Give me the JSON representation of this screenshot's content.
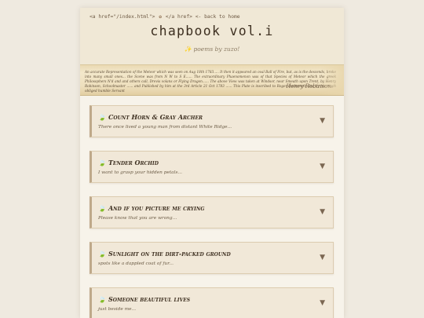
{
  "header": {
    "nav_open_tag": "<a href=\"/index.html\">",
    "nav_flower": "✿",
    "nav_close_tag": "</a href>",
    "back_link": "<- back to home",
    "title": "chapbook vol.i",
    "subtitle": "✨ poems by zuzo!"
  },
  "banner": {
    "text": "An accurate Representation of the Meteor which was seen on Aug 18th 1783..... It then it appeared an oval Ball of Fire, but, as is the descends, broke into many small ones... the Scene was from N W to S E...... The extraordinary Phaenomenon was of that Species of Meteor which the greek Philosophers N'd and and others call, Drevis volans or Flying Dragon...... The above View was taken at Windsor, near Smeath upon Trent, by Henry Robinson, Schoolmaster ...... and Published by him at the 3rd Article 21 Oct 1783 ...... This Plate is inscribed to Roger Dodsworth Esq by his much obliged humble Servant",
    "signature": "Henry Robinson."
  },
  "poems": [
    {
      "title": "Count Horn & Gray Archer",
      "excerpt": "There once lived a young man from distant White Ridge..."
    },
    {
      "title": "Tender Orchid",
      "excerpt": "I want to grasp your hidden petals..."
    },
    {
      "title": "And if you picture me crying",
      "excerpt": "Please know that you are wrong..."
    },
    {
      "title": "Sunlight on the dirt-packed ground",
      "excerpt": "spots like a dappled coat of fur..."
    },
    {
      "title": "Someone beautiful lives",
      "excerpt": "just beside me..."
    }
  ],
  "icons": {
    "leaf": "leaf-icon",
    "chevron": "chevron-down-icon",
    "flower": "flower-icon"
  }
}
